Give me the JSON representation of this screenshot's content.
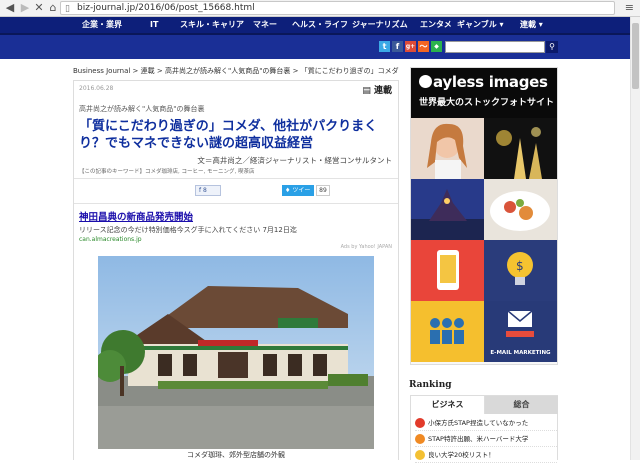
{
  "browser": {
    "url": "biz-journal.jp/2016/06/post_15668.html"
  },
  "nav": {
    "items": [
      "企業・業界",
      "IT",
      "スキル・キャリア",
      "マネー",
      "ヘルス・ライフ",
      "ジャーナリズム",
      "エンタメ",
      "ギャンブル ▾",
      "連載 ▾"
    ]
  },
  "social": {
    "icons": [
      "twitter-icon",
      "facebook-icon",
      "google-plus-icon",
      "rss-icon",
      "feedly-icon"
    ],
    "labels": [
      "t",
      "f",
      "g+",
      "〜",
      "◆"
    ],
    "colors": [
      "#3ba9e6",
      "#3b5998",
      "#dd4b39",
      "#f26522",
      "#2bb24c"
    ]
  },
  "breadcrumb": [
    "Business Journal",
    "連載",
    "高井尚之が読み解く\"人気商品\"の舞台裏",
    "「質にこだわり過ぎの」コメダ"
  ],
  "article": {
    "date": "2016.06.28",
    "series_badge": "連載",
    "series": "高井尚之が読み解く\"人気商品\"の舞台裏",
    "title": "「質にこだわり過ぎの」コメダ、他社がパクりまくり？でもマネできない謎の超高収益経営",
    "byline": "文＝高井尚之／経済ジャーナリスト・経営コンサルタント",
    "keywords": "【この記事のキーワード】コメダ珈琲店, コーヒー, モーニング, 喫茶店",
    "fb_count": "8",
    "tweet_label": "ツイート",
    "tweet_count": "89"
  },
  "inline_ad": {
    "title": "神田昌典の新商品発売開始",
    "desc": "リリース記念の今だけ特別価格今スグ手に入れてください 7月12日迄",
    "url": "can.almacreations.jp",
    "ads_by": "Ads by Yahoo! JAPAN"
  },
  "photo": {
    "caption": "コメダ珈琲、郊外型店舗の外観"
  },
  "sidebar_ad": {
    "brand": "ayless images",
    "tagline": "世界最大のストックフォトサイト",
    "email_label": "E-MAIL MARKETING"
  },
  "ranking": {
    "title": "Ranking",
    "tabs": [
      "ビジネス",
      "総合"
    ],
    "items": [
      "小保方氏STAP捏造していなかった",
      "STAP特許出願、米ハーバード大学",
      "良い大学20校リスト！"
    ]
  }
}
